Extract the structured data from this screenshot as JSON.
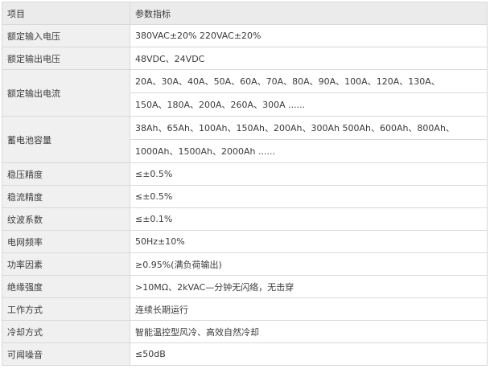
{
  "header": {
    "item": "项目",
    "spec": "参数指标"
  },
  "rows": [
    {
      "label": "额定输入电压",
      "values": [
        "380VAC±20%   220VAC±20%"
      ]
    },
    {
      "label": "额定输出电压",
      "values": [
        "48VDC、24VDC"
      ]
    },
    {
      "label": "额定输出电流",
      "values": [
        "20A、30A、40A、50A、60A、70A、80A、90A、100A、120A、130A、",
        "150A、180A、200A、260A、300A ......"
      ]
    },
    {
      "label": "蓄电池容量",
      "values": [
        "38Ah、65Ah、100Ah、150Ah、200Ah、300Ah 500Ah、600Ah、800Ah、",
        "1000Ah、1500Ah、2000Ah ......"
      ]
    },
    {
      "label": "稳压精度",
      "values": [
        "≤±0.5%"
      ]
    },
    {
      "label": "稳流精度",
      "values": [
        "≤±0.5%"
      ]
    },
    {
      "label": "纹波系数",
      "values": [
        "≤±0.1%"
      ]
    },
    {
      "label": "电网频率",
      "values": [
        "50Hz±10%"
      ]
    },
    {
      "label": "功率因素",
      "values": [
        "≥0.95%(满负荷输出)"
      ]
    },
    {
      "label": "绝缘强度",
      "values": [
        ">10MΩ、2kVAC—分钟无闪络，无击穿"
      ]
    },
    {
      "label": "工作方式",
      "values": [
        "连续长期运行"
      ]
    },
    {
      "label": "冷却方式",
      "values": [
        "智能温控型风冷、高效自然冷却"
      ]
    },
    {
      "label": "可闻噪音",
      "values": [
        "≤50dB"
      ]
    }
  ]
}
